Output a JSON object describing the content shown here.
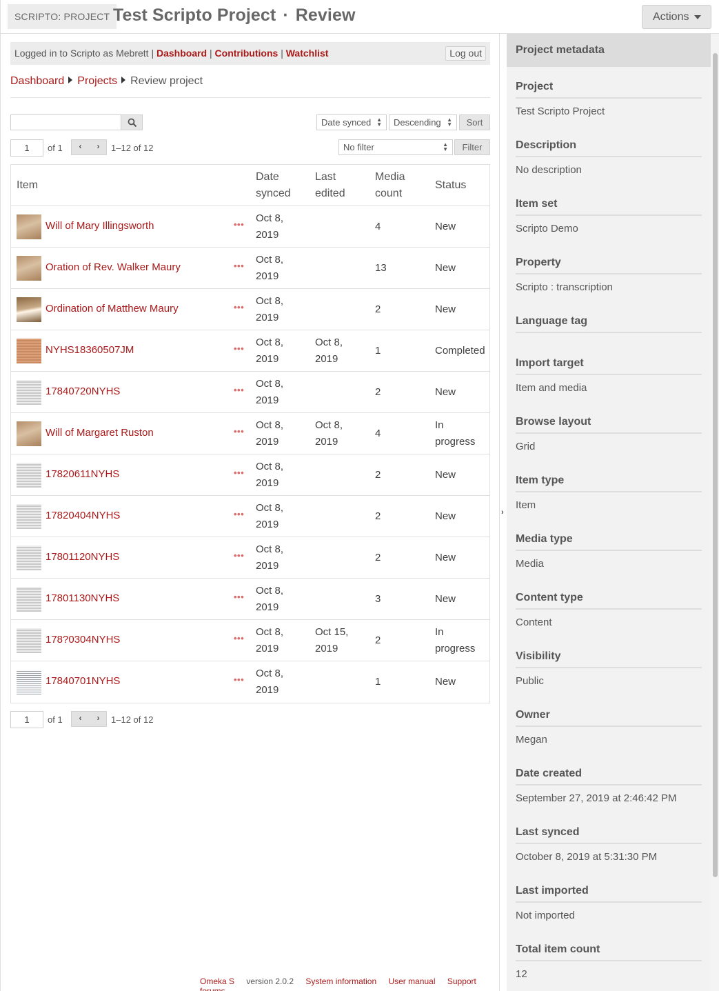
{
  "header": {
    "brand": "SCRIPTO: PROJECT",
    "project_title": "Test Scripto Project",
    "separator": "·",
    "page_name": "Review",
    "actions_label": "Actions"
  },
  "loginbar": {
    "prefix": "Logged in to Scripto as Mebrett",
    "sep": "|",
    "links": [
      "Dashboard",
      "Contributions",
      "Watchlist"
    ],
    "logout_label": "Log out"
  },
  "breadcrumb": [
    "Dashboard",
    "Projects",
    "Review project"
  ],
  "controls": {
    "search_value": "",
    "sort_by": "Date synced",
    "sort_order": "Descending",
    "sort_label": "Sort",
    "filter_value": "No filter",
    "filter_label": "Filter"
  },
  "pagination": {
    "page": "1",
    "of": "of 1",
    "range": "1–12 of 12"
  },
  "table": {
    "headers": {
      "item": "Item",
      "date_synced": [
        "Date",
        "synced"
      ],
      "last_edited": [
        "Last",
        "edited"
      ],
      "media_count": [
        "Media",
        "count"
      ],
      "status": "Status"
    },
    "rows": [
      {
        "title": "Will of Mary Illingsworth",
        "synced": [
          "Oct 8,",
          "2019"
        ],
        "edited": [
          "",
          ""
        ],
        "media": "4",
        "status": [
          "New"
        ],
        "thumb": "sepia"
      },
      {
        "title": "Oration of Rev. Walker Maury",
        "synced": [
          "Oct 8,",
          "2019"
        ],
        "edited": [
          "",
          ""
        ],
        "media": "13",
        "status": [
          "New"
        ],
        "thumb": "sepia"
      },
      {
        "title": "Ordination of Matthew Maury",
        "synced": [
          "Oct 8,",
          "2019"
        ],
        "edited": [
          "",
          ""
        ],
        "media": "2",
        "status": [
          "New"
        ],
        "thumb": "sepia-dark"
      },
      {
        "title": "NYHS18360507JM",
        "synced": [
          "Oct 8,",
          "2019"
        ],
        "edited": [
          "Oct 8,",
          "2019"
        ],
        "media": "1",
        "status": [
          "Completed"
        ],
        "thumb": "orange"
      },
      {
        "title": "17840720NYHS",
        "synced": [
          "Oct 8,",
          "2019"
        ],
        "edited": [
          "",
          ""
        ],
        "media": "2",
        "status": [
          "New"
        ],
        "thumb": "gray"
      },
      {
        "title": "Will of Margaret Ruston",
        "synced": [
          "Oct 8,",
          "2019"
        ],
        "edited": [
          "Oct 8,",
          "2019"
        ],
        "media": "4",
        "status": [
          "In",
          "progress"
        ],
        "thumb": "sepia"
      },
      {
        "title": "17820611NYHS",
        "synced": [
          "Oct 8,",
          "2019"
        ],
        "edited": [
          "",
          ""
        ],
        "media": "2",
        "status": [
          "New"
        ],
        "thumb": "gray"
      },
      {
        "title": "17820404NYHS",
        "synced": [
          "Oct 8,",
          "2019"
        ],
        "edited": [
          "",
          ""
        ],
        "media": "2",
        "status": [
          "New"
        ],
        "thumb": "gray"
      },
      {
        "title": "17801120NYHS",
        "synced": [
          "Oct 8,",
          "2019"
        ],
        "edited": [
          "",
          ""
        ],
        "media": "2",
        "status": [
          "New"
        ],
        "thumb": "gray"
      },
      {
        "title": "17801130NYHS",
        "synced": [
          "Oct 8,",
          "2019"
        ],
        "edited": [
          "",
          ""
        ],
        "media": "3",
        "status": [
          "New"
        ],
        "thumb": "gray"
      },
      {
        "title": "178?0304NYHS",
        "synced": [
          "Oct 8,",
          "2019"
        ],
        "edited": [
          "Oct 15,",
          "2019"
        ],
        "media": "2",
        "status": [
          "In",
          "progress"
        ],
        "thumb": "gray"
      },
      {
        "title": "17840701NYHS",
        "synced": [
          "Oct 8,",
          "2019"
        ],
        "edited": [
          "",
          ""
        ],
        "media": "1",
        "status": [
          "New"
        ],
        "thumb": "text"
      }
    ]
  },
  "footer": [
    "Omeka S",
    "version 2.0.2",
    "System information",
    "User manual",
    "Support forums"
  ],
  "sidebar": {
    "title": "Project metadata",
    "fields": [
      {
        "label": "Project",
        "value": "Test Scripto Project",
        "link": true
      },
      {
        "label": "Description",
        "value": "No description",
        "link": false
      },
      {
        "label": "Item set",
        "value": "Scripto Demo",
        "link": true
      },
      {
        "label": "Property",
        "value": "Scripto : transcription",
        "link": false
      },
      {
        "label": "Language tag",
        "value": "",
        "link": false
      },
      {
        "label": "Import target",
        "value": "Item and media",
        "link": false
      },
      {
        "label": "Browse layout",
        "value": "Grid",
        "link": false
      },
      {
        "label": "Item type",
        "value": "Item",
        "link": false
      },
      {
        "label": "Media type",
        "value": "Media",
        "link": false
      },
      {
        "label": "Content type",
        "value": "Content",
        "link": false
      },
      {
        "label": "Visibility",
        "value": "Public",
        "link": false
      },
      {
        "label": "Owner",
        "value": "Megan",
        "link": true
      },
      {
        "label": "Date created",
        "value": "September 27, 2019 at 2:46:42 PM",
        "link": false
      },
      {
        "label": "Last synced",
        "value": "October 8, 2019 at 5:31:30 PM",
        "link": false
      },
      {
        "label": "Last imported",
        "value": "Not imported",
        "link": false
      },
      {
        "label": "Total item count",
        "value": "12",
        "link": false
      }
    ]
  },
  "colors": {
    "accent": "#a91919",
    "sidebar_bg": "#f2f2f2",
    "sidebar_head": "#dcdcdc"
  }
}
